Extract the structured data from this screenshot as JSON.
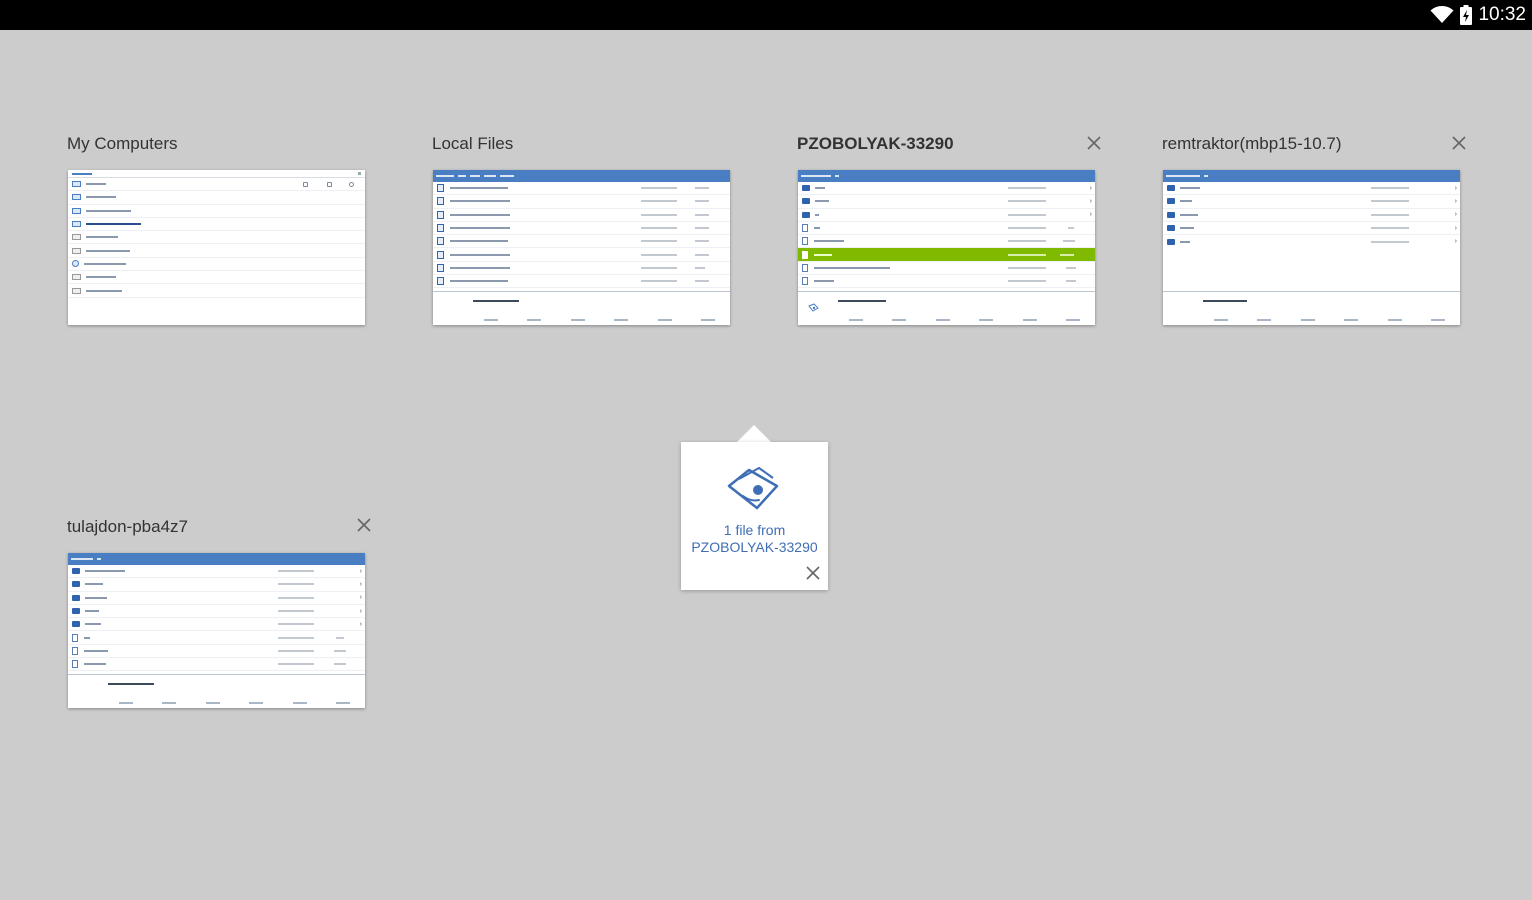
{
  "status_bar": {
    "time": "10:32",
    "icons": [
      "wifi-icon",
      "battery-icon"
    ]
  },
  "cards": [
    {
      "title": "My Computers",
      "closable": false,
      "active": false
    },
    {
      "title": "Local Files",
      "closable": false,
      "active": false
    },
    {
      "title": "PZOBOLYAK-33290",
      "closable": true,
      "active": true
    },
    {
      "title": "remtraktor(mbp15-10.7)",
      "closable": true,
      "active": false
    },
    {
      "title": "tulajdon-pba4z7",
      "closable": true,
      "active": false
    }
  ],
  "transfer_popover": {
    "icon": "file-transfer-icon",
    "line1": "1 file from",
    "line2": "PZOBOLYAK-33290",
    "close_icon": "close-icon"
  },
  "colors": {
    "background": "#cccccc",
    "accent_blue": "#4a7ec2",
    "selection_green": "#7fba00",
    "link_blue": "#3f6eb6"
  }
}
